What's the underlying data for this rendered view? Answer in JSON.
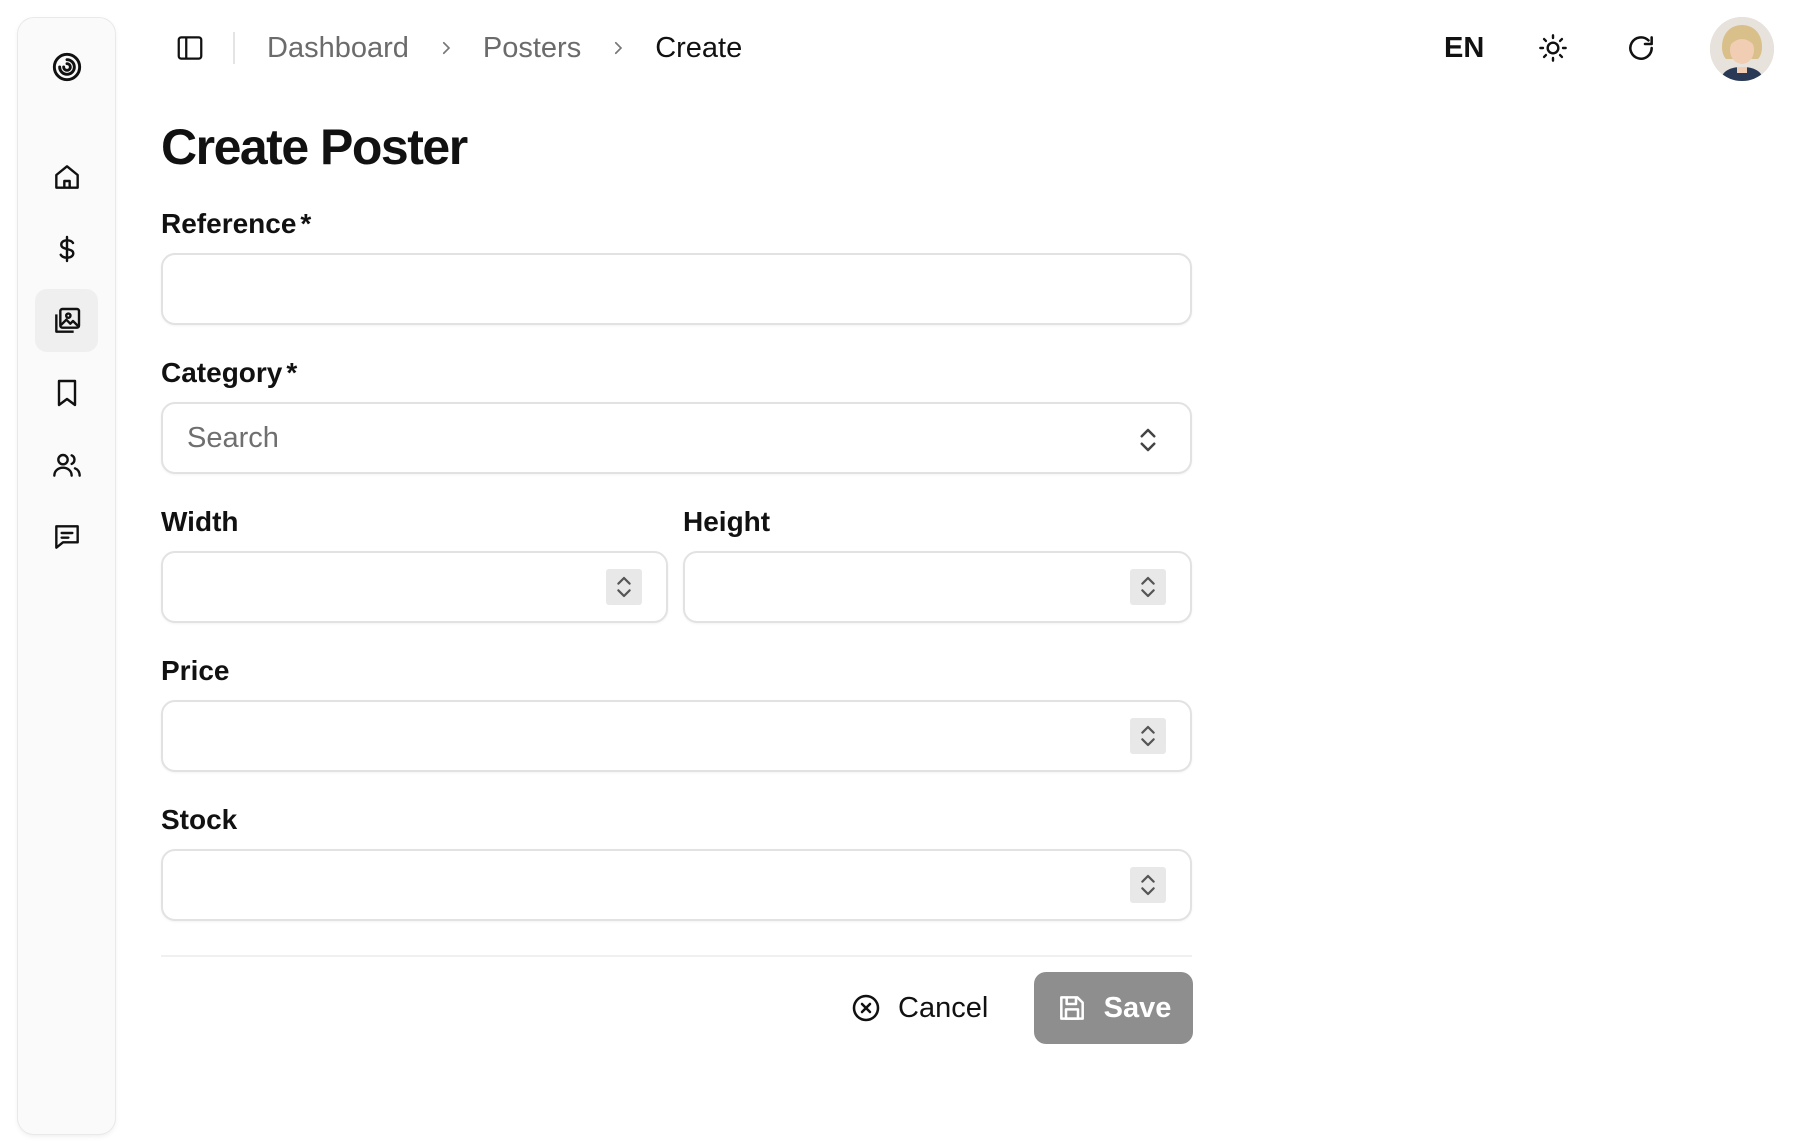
{
  "sidebar": {
    "logo": "spiral-logo-icon",
    "items": [
      {
        "icon": "home-icon",
        "active": false
      },
      {
        "icon": "dollar-icon",
        "active": false
      },
      {
        "icon": "images-icon",
        "active": true
      },
      {
        "icon": "bookmark-icon",
        "active": false
      },
      {
        "icon": "users-icon",
        "active": false
      },
      {
        "icon": "message-icon",
        "active": false
      }
    ]
  },
  "topbar": {
    "breadcrumb": [
      "Dashboard",
      "Posters",
      "Create"
    ],
    "language": "EN",
    "theme_icon": "sun-icon",
    "refresh_icon": "refresh-icon"
  },
  "page": {
    "title": "Create Poster"
  },
  "form": {
    "reference": {
      "label": "Reference",
      "required_mark": "*",
      "value": ""
    },
    "category": {
      "label": "Category",
      "required_mark": "*",
      "placeholder": "Search"
    },
    "width": {
      "label": "Width",
      "value": ""
    },
    "height": {
      "label": "Height",
      "value": ""
    },
    "price": {
      "label": "Price",
      "value": ""
    },
    "stock": {
      "label": "Stock",
      "value": ""
    }
  },
  "actions": {
    "cancel_label": "Cancel",
    "save_label": "Save"
  },
  "colors": {
    "save_button_bg": "#8e8e8e",
    "sidebar_bg": "#fafafa",
    "active_item_bg": "#efefef"
  }
}
